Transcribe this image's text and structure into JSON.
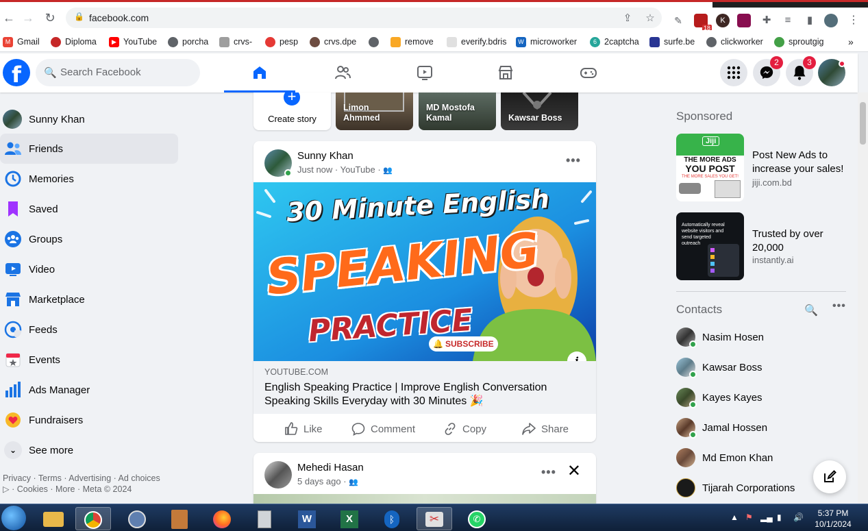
{
  "browser": {
    "url": "facebook.com",
    "ext_badge": "18",
    "bookmarks": [
      "Gmail",
      "Diploma",
      "YouTube",
      "porcha",
      "crvs-",
      "pesp",
      "crvs.dpe",
      "remove",
      "everify.bdris",
      "microworker",
      "2captcha",
      "surfe.be",
      "clickworker",
      "sproutgig"
    ]
  },
  "header": {
    "search_placeholder": "Search Facebook",
    "messenger_badge": "2",
    "notifications_badge": "3"
  },
  "left_nav": {
    "items": [
      "Sunny Khan",
      "Friends",
      "Memories",
      "Saved",
      "Groups",
      "Video",
      "Marketplace",
      "Feeds",
      "Events",
      "Ads Manager",
      "Fundraisers",
      "See more"
    ],
    "footer_line1": "Privacy · Terms · Advertising · Ad choices",
    "footer_line2": "· Cookies · More · Meta © 2024"
  },
  "stories": {
    "create_label": "Create story",
    "items": [
      "Limon Ahmmed",
      "MD Mostofa Kamal",
      "Kawsar Boss"
    ]
  },
  "post1": {
    "author": "Sunny Khan",
    "meta": "Just now · YouTube ·",
    "thumb_line1": "30 Minute English",
    "thumb_line2": "SPEAKING",
    "thumb_line3": "PRACTICE",
    "thumb_subscribe": "SUBSCRIBE",
    "link_domain": "YOUTUBE.COM",
    "link_title": "English Speaking Practice | Improve English Conversation Speaking Skills Everyday with 30 Minutes 🎉",
    "actions": [
      "Like",
      "Comment",
      "Copy",
      "Share"
    ]
  },
  "post2": {
    "author": "Mehedi Hasan",
    "meta": "5 days ago ·"
  },
  "sponsored": {
    "title": "Sponsored",
    "ads": [
      {
        "title": "Post New Ads to increase your sales!",
        "site": "jiji.com.bd",
        "img_brand": "Jiji",
        "img_line1": "THE MORE ADS",
        "img_line2": "YOU POST",
        "img_line3": "THE MORE SALES YOU GET!"
      },
      {
        "title": "Trusted by over 20,000",
        "site": "instantly.ai",
        "img_line1": "Automatically reveal website visitors and send targeted outreach"
      }
    ]
  },
  "contacts": {
    "title": "Contacts",
    "items": [
      "Nasim Hosen",
      "Kawsar Boss",
      "Kayes Kayes",
      "Jamal Hossen",
      "Md Emon Khan",
      "Tijarah Corporations"
    ]
  },
  "taskbar": {
    "time": "5:37 PM",
    "date": "10/1/2024"
  },
  "colors": {
    "fb_blue": "#0866ff",
    "badge_red": "#e41e3f",
    "online_green": "#31a24c"
  }
}
